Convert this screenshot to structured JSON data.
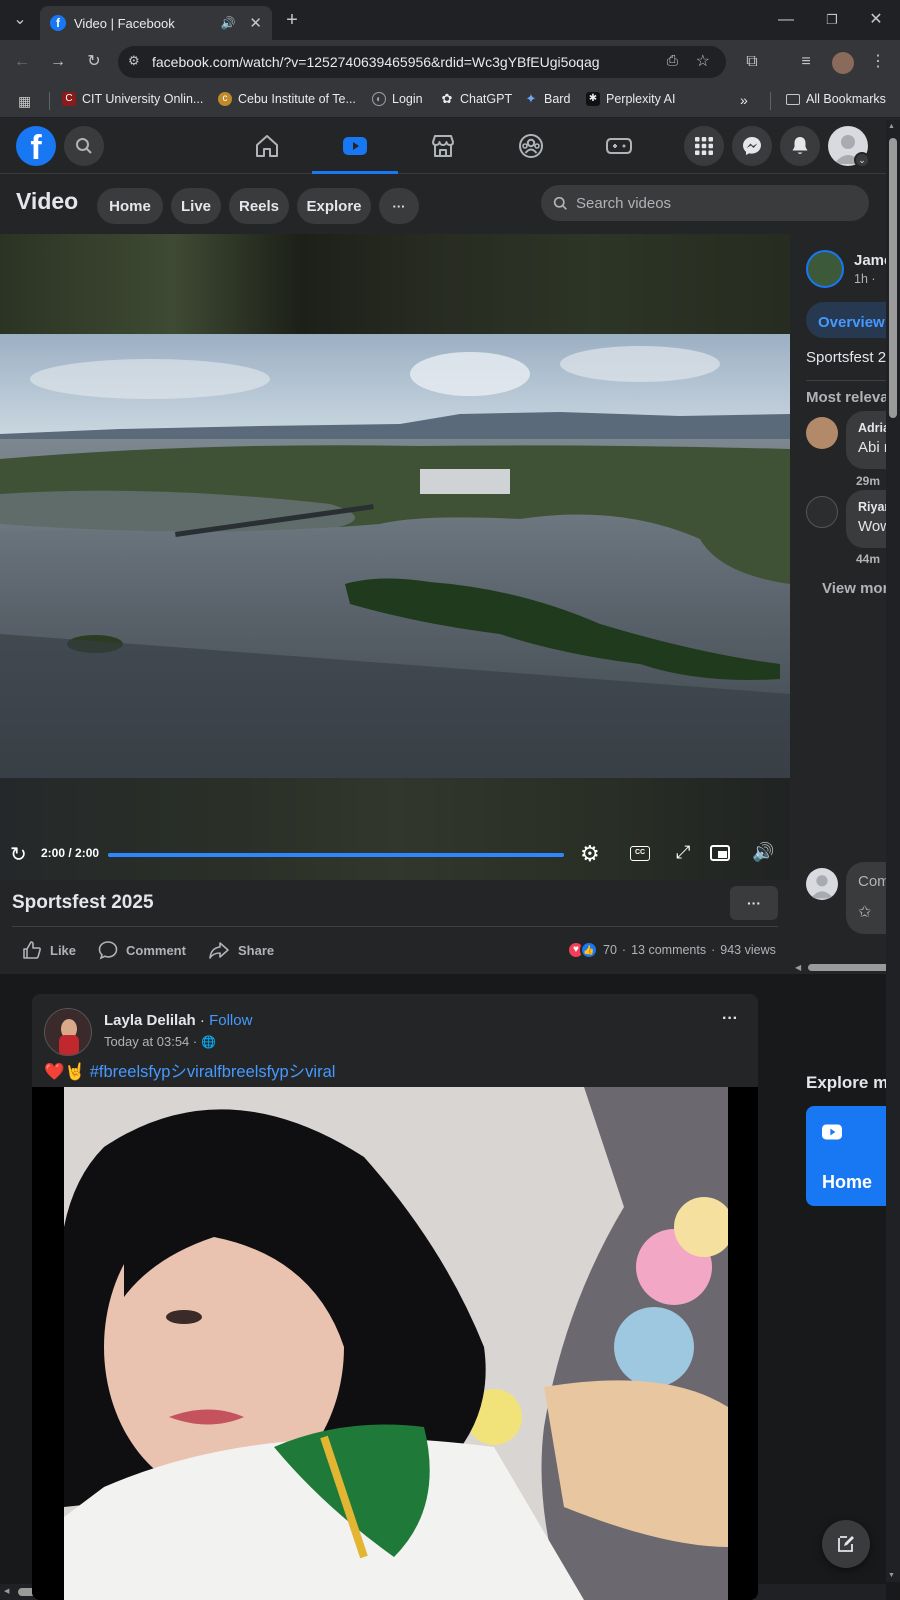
{
  "browser": {
    "tab_title": "Video | Facebook",
    "url": "facebook.com/watch/?v=1252740639465956&rdid=Wc3gYBfEUgi5oqag",
    "bookmarks": [
      "CIT University Onlin...",
      "Cebu Institute of Te...",
      "Login",
      "ChatGPT",
      "Bard",
      "Perplexity AI"
    ],
    "all_bookmarks": "All Bookmarks",
    "overflow": "»"
  },
  "fb": {
    "logo": "f",
    "page_title": "Video",
    "tabs": [
      "Home",
      "Live",
      "Reels",
      "Explore"
    ],
    "more": "···",
    "search_placeholder": "Search videos"
  },
  "player": {
    "time": "2:00 / 2:00",
    "progress_fraction": 1.0,
    "cc": "CC"
  },
  "video": {
    "title": "Sportsfest 2025",
    "more": "···",
    "actions": [
      "Like",
      "Comment",
      "Share"
    ],
    "reaction_count": "70",
    "comments": "13 comments",
    "views": "943 views",
    "sep": "·"
  },
  "side": {
    "author": "Jame",
    "time": "1h ·",
    "overview": "Overview",
    "desc": "Sportsfest 2",
    "most_relevant": "Most releva",
    "comments": [
      {
        "name": "Adria",
        "text": "Abi n",
        "time": "29m"
      },
      {
        "name": "Riyan",
        "text": "Wow",
        "time": "44m"
      }
    ],
    "view_more": "View mor",
    "comment_placeholder": "Com",
    "explore": "Explore mo",
    "home": "Home"
  },
  "post": {
    "author": "Layla Delilah",
    "dot": " · ",
    "follow": "Follow",
    "time": "Today at 03:54 ·",
    "emoji": "❤️🤘",
    "hashtag": "#fbreelsfypシviralfbreelsfypシviral",
    "more": "···"
  },
  "colors": {
    "fb_blue": "#1877f2",
    "bg": "#18191a",
    "card": "#242526",
    "link": "#4599ff"
  }
}
